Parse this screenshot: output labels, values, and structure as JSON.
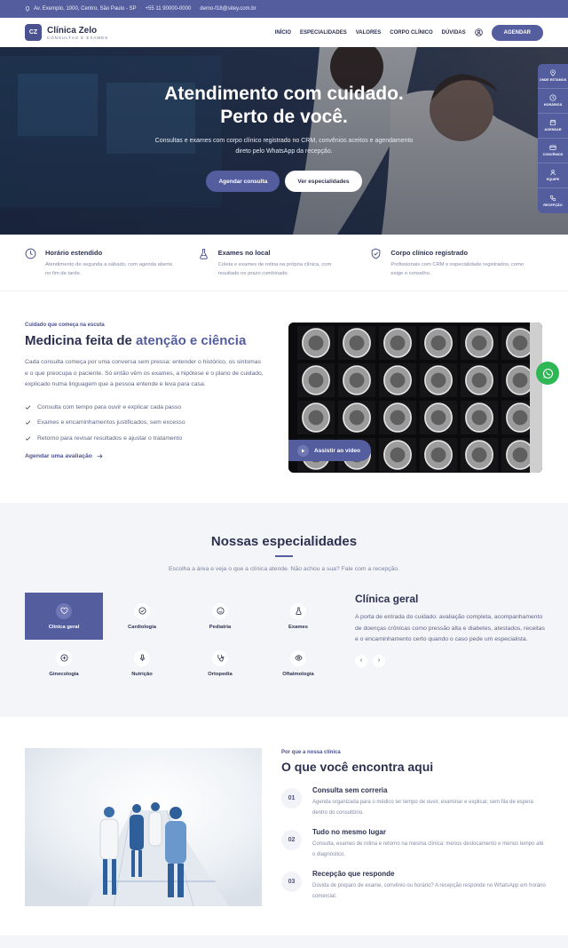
{
  "topbar": {
    "address": "Av. Exemplo, 1000, Centro, São Paulo - SP",
    "phone": "+55 11 90000-0000",
    "email": "demo-f18@sitey.com.br"
  },
  "brand": {
    "mark": "CZ",
    "name": "Clínica Zelo",
    "tagline": "CONSULTAS E EXAMES"
  },
  "nav": {
    "items": [
      "INÍCIO",
      "ESPECIALIDADES",
      "VALORES",
      "CORPO CLÍNICO",
      "DÚVIDAS"
    ],
    "cta": "AGENDAR"
  },
  "hero": {
    "title_line1": "Atendimento com cuidado.",
    "title_line2": "Perto de você.",
    "subtitle": "Consultas e exames com corpo clínico registrado no CRM, convênios aceitos e agendamento direto pelo WhatsApp da recepção.",
    "primary_button": "Agendar consulta",
    "secondary_button": "Ver especialidades"
  },
  "sidebar": {
    "items": [
      {
        "label": "ONDE ESTAMOS",
        "icon": "map-pin-icon"
      },
      {
        "label": "HORÁRIOS",
        "icon": "clock-icon"
      },
      {
        "label": "AGENDAR",
        "icon": "calendar-icon"
      },
      {
        "label": "CONVÊNIOS",
        "icon": "card-icon"
      },
      {
        "label": "EQUIPE",
        "icon": "team-icon"
      },
      {
        "label": "RECEPÇÃO",
        "icon": "phone-icon"
      }
    ]
  },
  "features": [
    {
      "title": "Horário estendido",
      "text": "Atendimento de segunda a sábado, com agenda aberta no fim de tarde.",
      "icon": "clock-icon"
    },
    {
      "title": "Exames no local",
      "text": "Coleta e exames de rotina na própria clínica, com resultado no prazo combinado.",
      "icon": "flask-icon"
    },
    {
      "title": "Corpo clínico registrado",
      "text": "Profissionais com CRM e especialidade registrados, como exige o conselho.",
      "icon": "shield-icon"
    }
  ],
  "about": {
    "eyebrow": "Cuidado que começa na escuta",
    "title_plain": "Medicina feita de ",
    "title_accent": "atenção e ciência",
    "description": "Cada consulta começa por uma conversa sem pressa: entender o histórico, os sintomas e o que preocupa o paciente. Só então vêm os exames, a hipótese e o plano de cuidado, explicado numa linguagem que a pessoa entende e leva para casa.",
    "checks": [
      "Consulta com tempo para ouvir e explicar cada passo",
      "Exames e encaminhamentos justificados, sem excesso",
      "Retorno para revisar resultados e ajustar o tratamento"
    ],
    "link": "Agendar uma avaliação",
    "video_button": "Assistir ao vídeo"
  },
  "specialties": {
    "title": "Nossas especialidades",
    "intro": "Escolha a área e veja o que a clínica atende. Não achou a sua? Fale com a recepção.",
    "items": [
      {
        "label": "Clínica geral",
        "icon": "heart-icon"
      },
      {
        "label": "Cardiologia",
        "icon": "check-circle-icon"
      },
      {
        "label": "Pediatria",
        "icon": "smile-icon"
      },
      {
        "label": "Exames",
        "icon": "flask-icon"
      },
      {
        "label": "Ginecologia",
        "icon": "plus-circle-icon"
      },
      {
        "label": "Nutrição",
        "icon": "microphone-icon"
      },
      {
        "label": "Ortopedia",
        "icon": "stethoscope-icon"
      },
      {
        "label": "Oftalmologia",
        "icon": "eye-icon"
      }
    ],
    "selected_index": 0,
    "detail_title": "Clínica geral",
    "detail_text": "A porta de entrada do cuidado: avaliação completa, acompanhamento de doenças crônicas como pressão alta e diabetes, atestados, receitas e o encaminhamento certo quando o caso pede um especialista.",
    "prev": "‹",
    "next": "›"
  },
  "why": {
    "eyebrow": "Por que a nossa clínica",
    "title": "O que você encontra aqui",
    "items": [
      {
        "num": "01",
        "title": "Consulta sem correria",
        "text": "Agenda organizada para o médico ter tempo de ouvir, examinar e explicar, sem fila de espera dentro do consultório."
      },
      {
        "num": "02",
        "title": "Tudo no mesmo lugar",
        "text": "Consulta, exames de rotina e retorno na mesma clínica: menos deslocamento e menos tempo até o diagnóstico."
      },
      {
        "num": "03",
        "title": "Recepção que responde",
        "text": "Dúvida de preparo de exame, convênio ou horário? A recepção responde no WhatsApp em horário comercial."
      }
    ]
  },
  "colors": {
    "primary": "#545d9e",
    "dark": "#2d3150",
    "whatsapp": "#2fb755"
  }
}
